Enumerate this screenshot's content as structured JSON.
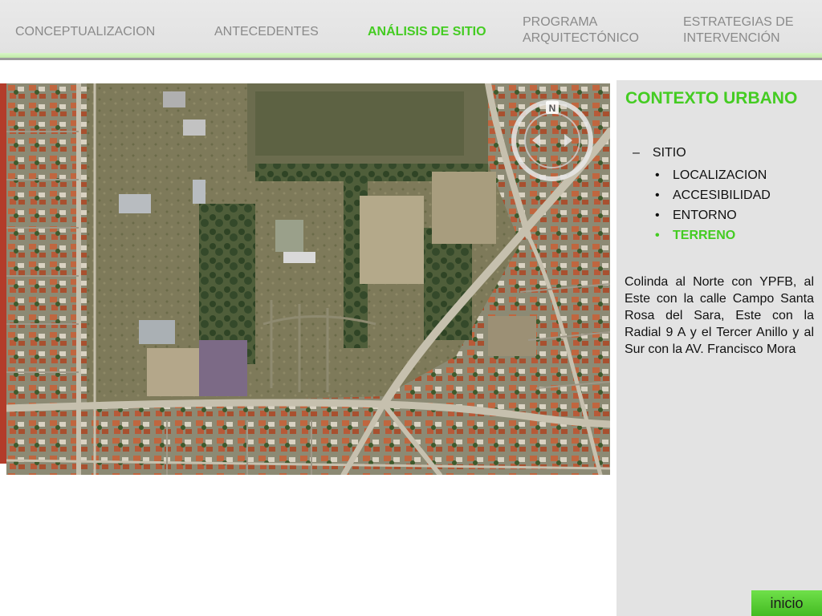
{
  "nav": {
    "items": [
      {
        "label": "CONCEPTUALIZACION"
      },
      {
        "label": "ANTECEDENTES"
      },
      {
        "label": "ANÁLISIS DE SITIO"
      },
      {
        "label": "PROGRAMA ARQUITECTÓNICO"
      },
      {
        "label": "ESTRATEGIAS DE INTERVENCIÓN"
      }
    ],
    "active_index": 2,
    "active_color": "#44cc22",
    "inactive_color": "#8a8a8a"
  },
  "panel": {
    "title": "CONTEXTO URBANO",
    "section": {
      "marker": "–",
      "label": "SITIO"
    },
    "items": [
      {
        "label": "LOCALIZACION"
      },
      {
        "label": "ACCESIBILIDAD"
      },
      {
        "label": "ENTORNO"
      },
      {
        "label": "TERRENO"
      }
    ],
    "active_item_index": 3,
    "description": "Colinda al Norte con YPFB, al Este con la calle Campo Santa Rosa del Sara, Este con la Radial 9 A y el Tercer Anillo y al Sur con la AV. Francisco Mora"
  },
  "map": {
    "compass_label": "N",
    "icons": [
      "compass-icon",
      "map-arrow-left-icon",
      "map-arrow-right-icon"
    ]
  },
  "footer": {
    "inicio_label": "inicio"
  },
  "colors": {
    "accent_green": "#44cc22",
    "panel_bg": "#e3e3e3",
    "nav_bg": "#e6e6e6"
  }
}
